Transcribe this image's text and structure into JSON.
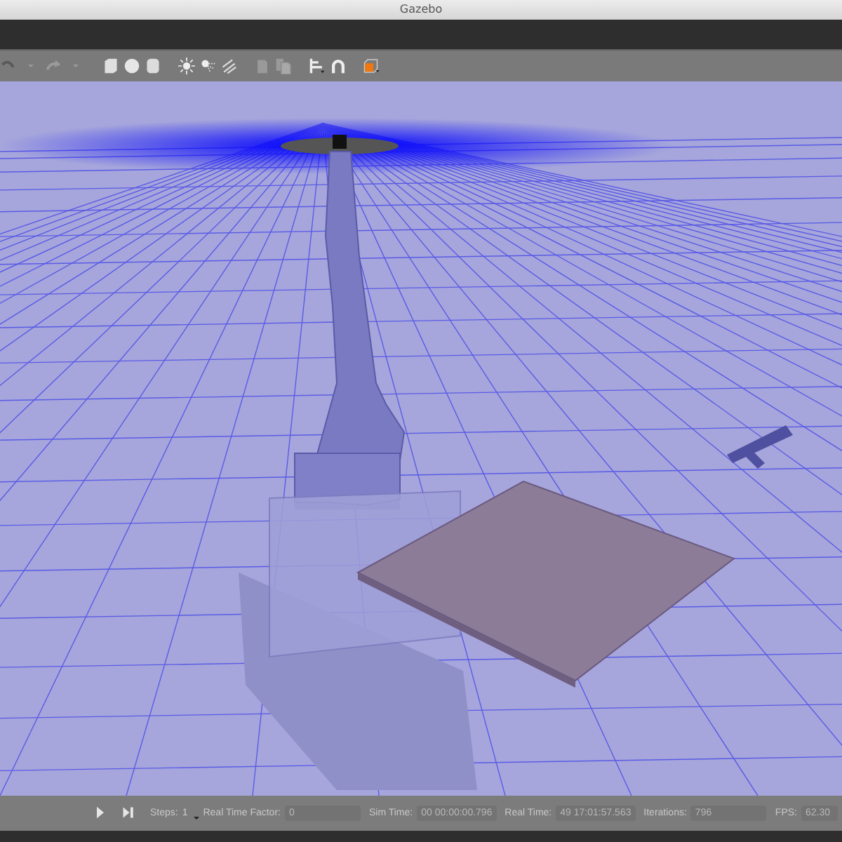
{
  "window": {
    "title": "Gazebo"
  },
  "status_bar": {
    "steps_label": "Steps:",
    "steps_value": "1",
    "fields": [
      {
        "label": "Real Time Factor:",
        "value": "0",
        "kind": "wide"
      },
      {
        "label": "Sim Time:",
        "value": "00 00:00:00.796",
        "kind": "normal"
      },
      {
        "label": "Real Time:",
        "value": "49 17:01:57.563",
        "kind": "normal"
      },
      {
        "label": "Iterations:",
        "value": "796",
        "kind": "normal"
      },
      {
        "label": "FPS:",
        "value": "62.30",
        "kind": "edge"
      }
    ]
  }
}
